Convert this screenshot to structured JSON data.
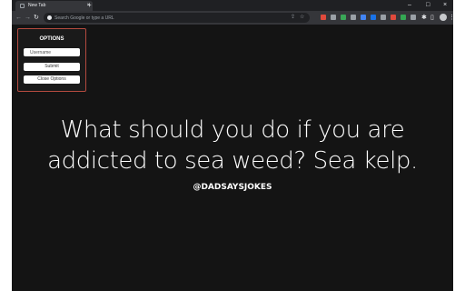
{
  "browser": {
    "tab_title": "New Tab",
    "tab_close_icon": "×",
    "new_tab_icon": "+",
    "window_controls": [
      "–",
      "□",
      "×"
    ],
    "omnibox_placeholder": "Search Google or type a URL",
    "icons": [
      "back-icon",
      "forward-icon",
      "reload-icon",
      "share-icon",
      "star-icon",
      "extensions-puzzle-icon",
      "sidebar-icon",
      "profile-avatar",
      "more-menu-icon"
    ],
    "extension_colors": [
      "#e04a3c",
      "#9aa0a6",
      "#3aa757",
      "#9aa0a6",
      "#4285f4",
      "#1a73e8",
      "#9aa0a6",
      "#e04a3c",
      "#34a853",
      "#9aa0a6",
      "#9aa0a6"
    ]
  },
  "options": {
    "title": "OPTIONS",
    "username_placeholder": "Username",
    "submit_label": "Submit",
    "close_label": "Close Options",
    "border_color": "#b44a3f"
  },
  "joke": {
    "text": "What should you do if you are addicted to sea weed? Sea kelp.",
    "handle": "@DADSAYSJOKES"
  }
}
